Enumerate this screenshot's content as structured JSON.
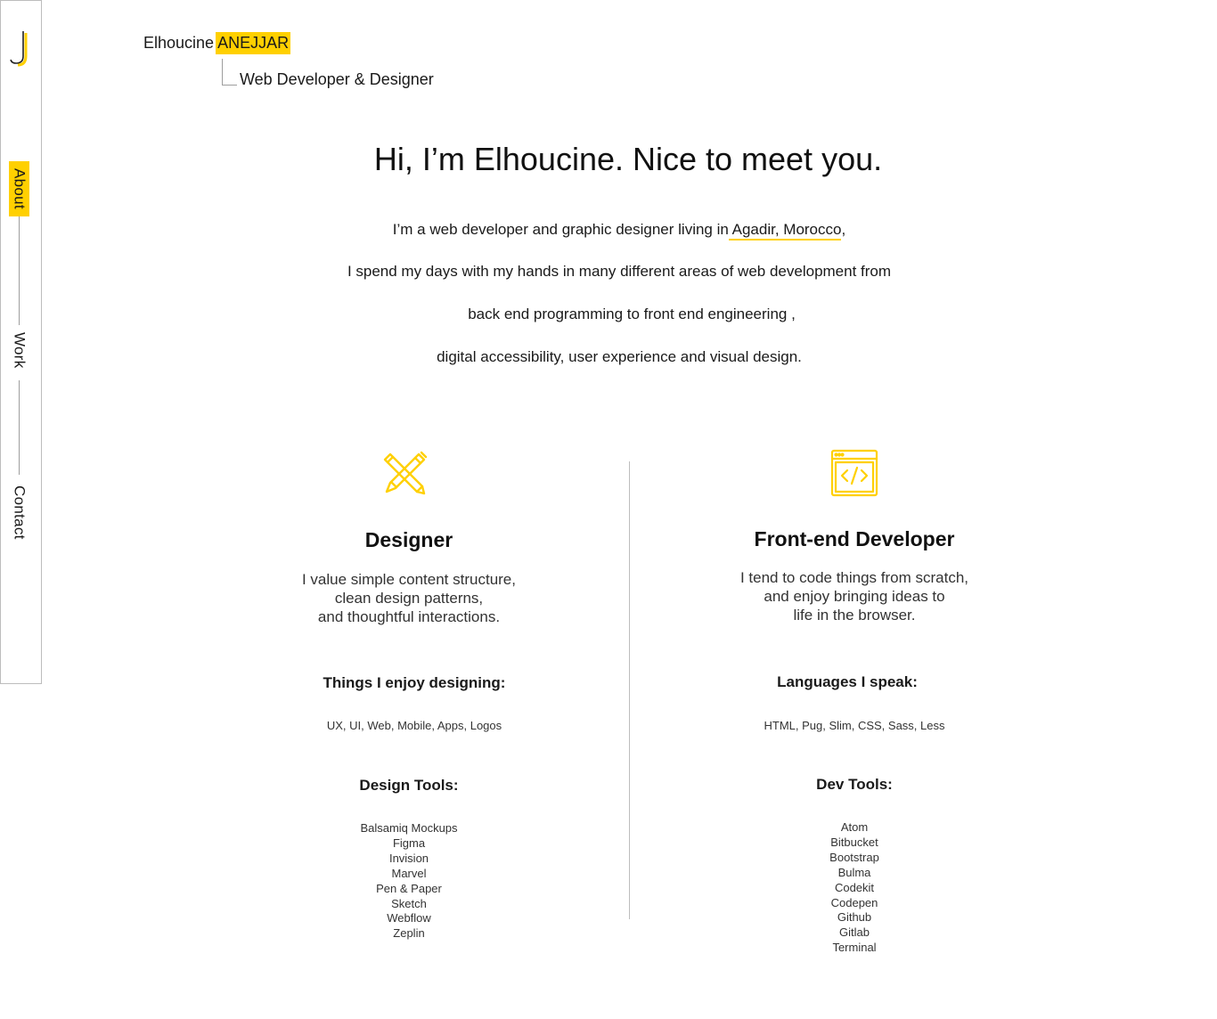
{
  "brand": {
    "first_name": "Elhoucine",
    "last_name": "ANEJJAR",
    "tagline": "Web Developer & Designer"
  },
  "nav": {
    "items": [
      {
        "label": "About",
        "active": true
      },
      {
        "label": "Work",
        "active": false
      },
      {
        "label": "Contact",
        "active": false
      }
    ]
  },
  "intro": {
    "title": "Hi, I’m Elhoucine. Nice to meet you.",
    "line1_before": "I’m a web developer and graphic designer living in",
    "location": " Agadir, Morocco",
    "line1_after": ",",
    "line2": "I spend my days with my hands in many different areas of web development from",
    "line3": "back end programming to front end engineering ,",
    "line4": "digital accessibility, user experience and visual design."
  },
  "designer": {
    "icon": "pencil-pen-icon",
    "title": "Designer",
    "desc": [
      "I value simple content structure,",
      "clean design patterns,",
      "and thoughtful interactions."
    ],
    "things_heading": "Things I enjoy designing:",
    "things": "UX, UI, Web, Mobile, Apps, Logos",
    "tools_heading": "Design Tools:",
    "tools": [
      "Balsamiq Mockups",
      "Figma",
      "Invision",
      "Marvel",
      "Pen & Paper",
      "Sketch",
      "Webflow",
      "Zeplin"
    ]
  },
  "developer": {
    "icon": "code-window-icon",
    "title": "Front-end Developer",
    "desc": [
      "I tend to code things from scratch,",
      "and enjoy bringing ideas to",
      "life in the browser."
    ],
    "languages_heading": "Languages I speak:",
    "languages": "HTML, Pug, Slim, CSS, Sass, Less",
    "tools_heading": "Dev Tools:",
    "tools": [
      "Atom",
      "Bitbucket",
      "Bootstrap",
      "Bulma",
      "Codekit",
      "Codepen",
      "Github",
      "Gitlab",
      "Terminal"
    ]
  },
  "colors": {
    "accent": "#ffd000",
    "text": "#1a1a1a",
    "border": "#bdbdbd"
  }
}
